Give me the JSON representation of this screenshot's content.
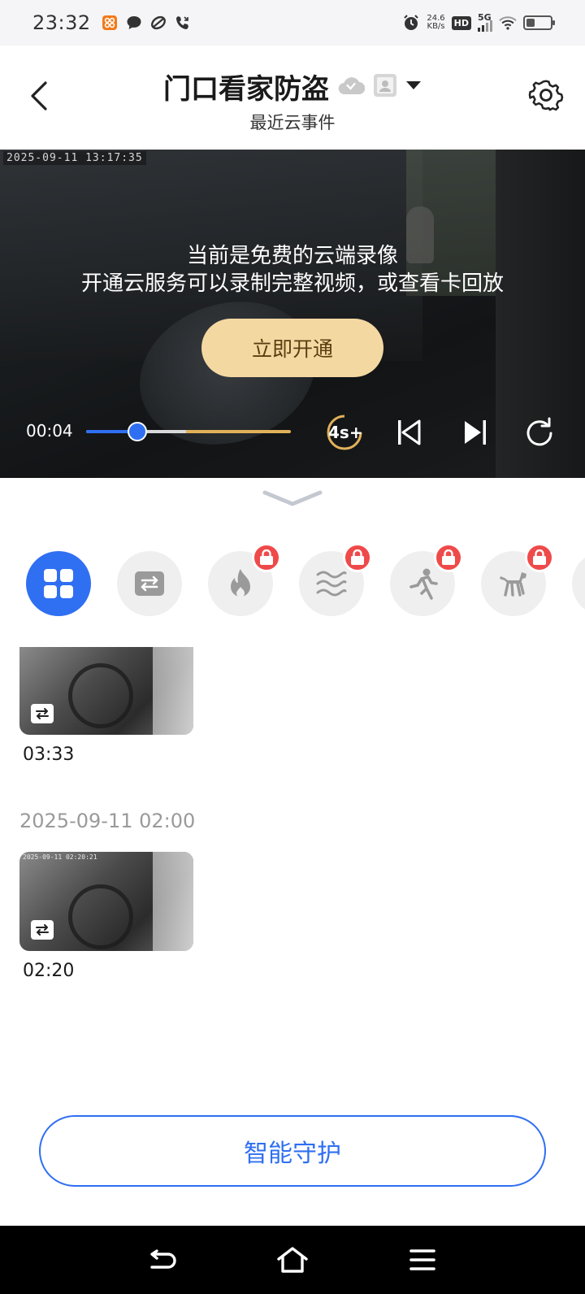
{
  "status_bar": {
    "time": "23:32",
    "net_speed_value": "24.6",
    "net_speed_unit": "KB/s",
    "hd_label": "HD",
    "network_label": "5G",
    "battery_level": 0.35
  },
  "header": {
    "title": "门口看家防盗",
    "subtitle": "最近云事件"
  },
  "video": {
    "osd_timestamp": "2025-09-11  13:17:35",
    "overlay_line1": "当前是免费的云端录像",
    "overlay_line2": "开通云服务可以录制完整视频，或查看卡回放",
    "open_button_label": "立即开通",
    "current_time": "00:04",
    "playback_progress": 0.25,
    "skip_label": "4s+"
  },
  "filters": [
    {
      "name": "all",
      "icon": "grid-icon",
      "active": true,
      "locked": false
    },
    {
      "name": "motion",
      "icon": "swap-icon",
      "active": false,
      "locked": false
    },
    {
      "name": "fire",
      "icon": "fire-icon",
      "active": false,
      "locked": true
    },
    {
      "name": "smoke",
      "icon": "waves-icon",
      "active": false,
      "locked": true
    },
    {
      "name": "person",
      "icon": "running-person-icon",
      "active": false,
      "locked": true
    },
    {
      "name": "pet",
      "icon": "dog-icon",
      "active": false,
      "locked": true
    }
  ],
  "events": [
    {
      "time": "03:33",
      "osd": ""
    },
    {
      "time": "02:20",
      "osd": "2025-09-11  02:20:21"
    }
  ],
  "group_date": "2025-09-11 02:00",
  "guard_button_label": "智能守护",
  "colors": {
    "accent": "#2f6ff2",
    "open_button_bg": "#f4d8a2",
    "lock_badge": "#ef4a4a"
  }
}
